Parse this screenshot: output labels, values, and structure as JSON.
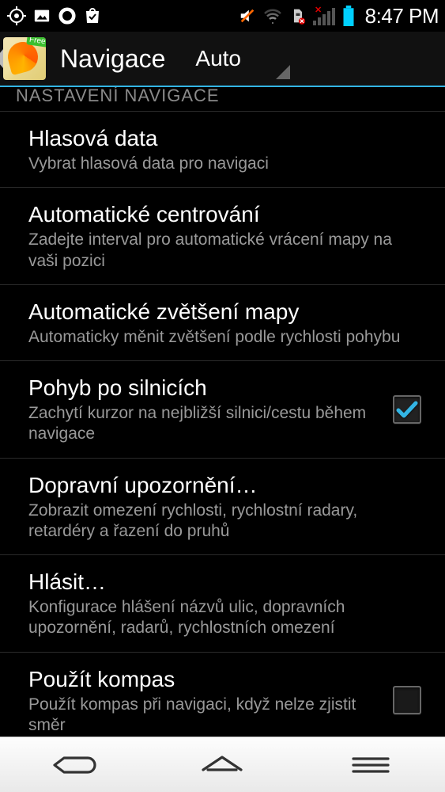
{
  "status": {
    "time": "8:47 PM"
  },
  "actionbar": {
    "title": "Navigace",
    "spinner": "Auto",
    "badge": "Free"
  },
  "section_header": "NASTAVENÍ NAVIGACE",
  "items": [
    {
      "title": "Hlasová data",
      "sub": "Vybrat hlasová data pro navigaci",
      "check": null
    },
    {
      "title": "Automatické centrování",
      "sub": "Zadejte interval pro automatické vrácení mapy na vaši pozici",
      "check": null
    },
    {
      "title": "Automatické zvětšení mapy",
      "sub": "Automaticky měnit zvětšení podle rychlosti pohybu",
      "check": null
    },
    {
      "title": "Pohyb po silnicích",
      "sub": "Zachytí kurzor na nejbližší silnici/cestu během navigace",
      "check": true
    },
    {
      "title": "Dopravní upozornění…",
      "sub": "Zobrazit omezení rychlosti, rychlostní radary, retardéry a řazení do pruhů",
      "check": null
    },
    {
      "title": "Hlásit…",
      "sub": "Konfigurace hlášení názvů ulic, dopravních upozornění, radarů, rychlostních omezení",
      "check": null
    },
    {
      "title": "Použít kompas",
      "sub": "Použít kompas při navigaci, když nelze zjistit směr",
      "check": false
    }
  ]
}
